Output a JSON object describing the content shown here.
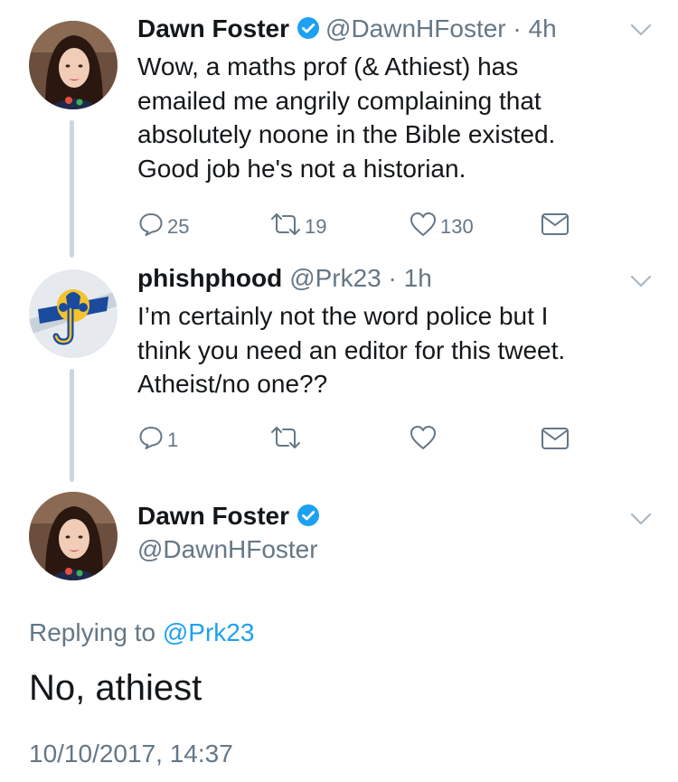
{
  "tweets": [
    {
      "display_name": "Dawn Foster",
      "handle": "@DawnHFoster",
      "time": "4h",
      "verified": true,
      "lines": [
        "Wow, a maths prof (& Athiest) has",
        "emailed me angrily complaining that",
        "absolutely noone in the Bible existed.",
        "Good job he's not a historian."
      ],
      "replies": "25",
      "retweets": "19",
      "likes": "130"
    },
    {
      "display_name": "phishphood",
      "handle": "@Prk23",
      "time": "1h",
      "verified": false,
      "lines": [
        "I’m certainly not the word police but I",
        "think you need an editor for this tweet.",
        "Atheist/no one??"
      ],
      "replies": "1",
      "retweets": "",
      "likes": ""
    }
  ],
  "main_tweet": {
    "display_name": "Dawn Foster",
    "handle": "@DawnHFoster",
    "verified": true,
    "replying_prefix": "Replying to",
    "replying_to": "@Prk23",
    "text": "No, athiest",
    "timestamp": "10/10/2017, 14:37"
  },
  "colors": {
    "link": "#1da1f2",
    "muted": "#657786",
    "thread_line": "#ccd6dd",
    "verified": "#1da1f2"
  }
}
